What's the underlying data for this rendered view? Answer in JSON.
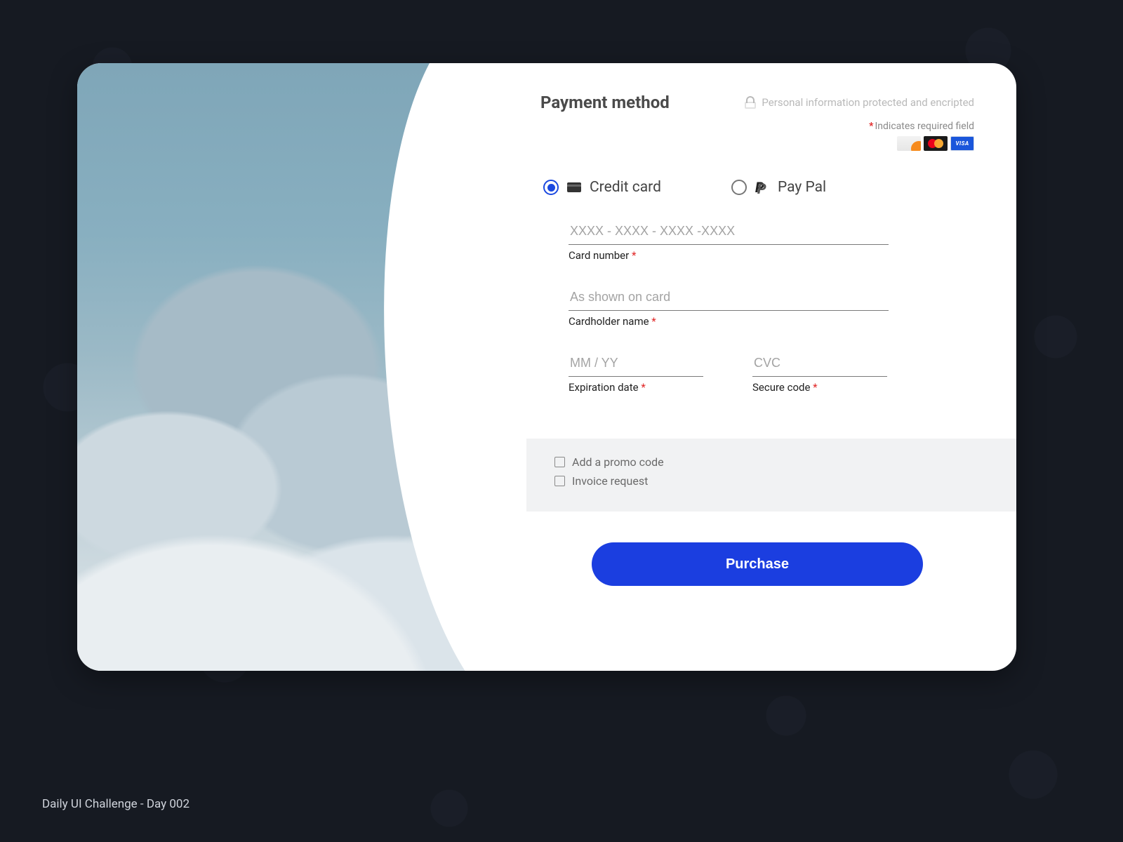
{
  "header": {
    "title": "Payment method",
    "protected_text": "Personal information protected and encripted",
    "required_note": "Indicates required field"
  },
  "card_brands": [
    "DISCOVER",
    "mastercard",
    "VISA"
  ],
  "methods": {
    "credit_card": {
      "label": "Credit card",
      "selected": true
    },
    "paypal": {
      "label": "Pay Pal",
      "selected": false
    }
  },
  "fields": {
    "card_number": {
      "label": "Card number",
      "placeholder": "XXXX - XXXX - XXXX -XXXX",
      "required": true,
      "value": ""
    },
    "cardholder": {
      "label": "Cardholder name",
      "placeholder": "As shown on card",
      "required": true,
      "value": ""
    },
    "expiration": {
      "label": "Expiration date",
      "placeholder": "MM / YY",
      "required": true,
      "value": ""
    },
    "cvc": {
      "label": "Secure code",
      "placeholder": "CVC",
      "required": true,
      "value": ""
    }
  },
  "extras": {
    "promo": {
      "label": "Add a promo code",
      "checked": false
    },
    "invoice": {
      "label": "Invoice request",
      "checked": false
    }
  },
  "cta": {
    "label": "Purchase"
  },
  "footer": "Daily UI Challenge - Day 002",
  "colors": {
    "accent": "#1b3ee0",
    "required_star": "#e02424"
  }
}
